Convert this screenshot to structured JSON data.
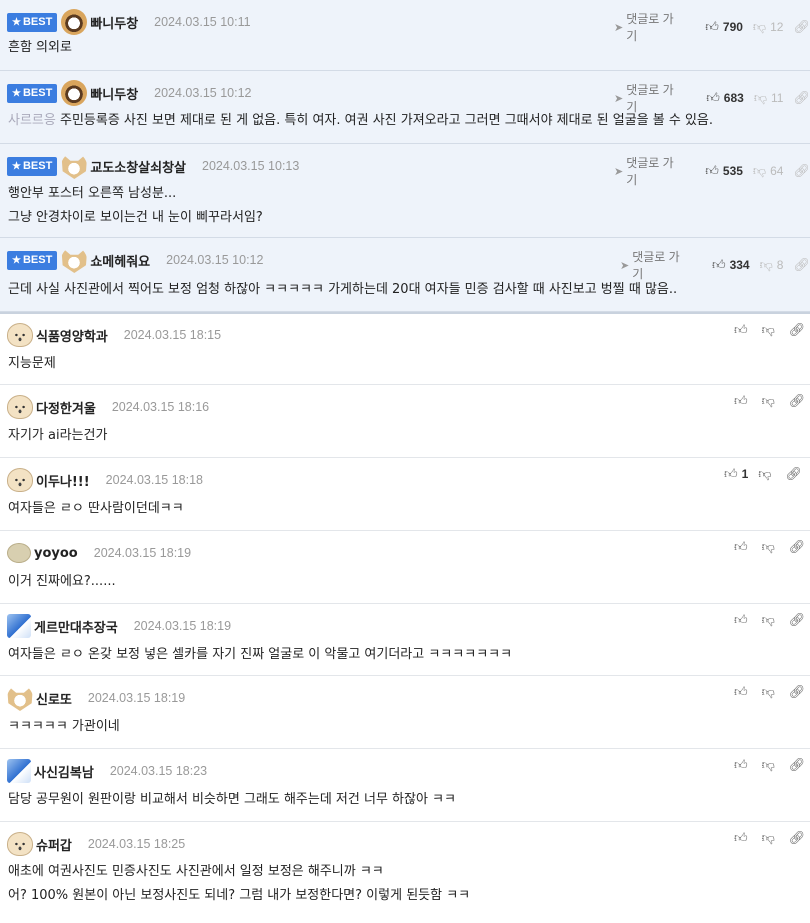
{
  "best_label": "BEST",
  "reply_label": "댓글로 가기",
  "best_comments": [
    {
      "nick": "빠니두창",
      "date": "2024.03.15 10:11",
      "up": "790",
      "down": "12",
      "lines": [
        "흔함 의외로"
      ]
    },
    {
      "nick": "빠니두창",
      "date": "2024.03.15 10:12",
      "up": "683",
      "down": "11",
      "reply_to": "사르르응",
      "lines": [
        "주민등록증 사진 보면 제대로 된 게 없음. 특히 여자. 여권 사진 가져오라고 그러면 그때서야 제대로 된 얼굴을 볼 수 있음."
      ]
    },
    {
      "nick": "교도소창살쇠창살",
      "date": "2024.03.15 10:13",
      "up": "535",
      "down": "64",
      "lines": [
        "행안부 포스터 오른쪽 남성분...",
        "그냥 안경차이로 보이는건 내 눈이 삐꾸라서임?"
      ]
    },
    {
      "nick": "쇼메헤줘요",
      "date": "2024.03.15 10:12",
      "up": "334",
      "down": "8",
      "lines": [
        "근데 사실 사진관에서 찍어도 보정 엄청 하잖아 ㅋㅋㅋㅋㅋ 가게하는데 20대 여자들 민증 검사할 때 사진보고 벙찔 때 많음.."
      ]
    }
  ],
  "comments": [
    {
      "nick": "식품영양학과",
      "date": "2024.03.15 18:15",
      "up": "",
      "lines": [
        "지능문제"
      ]
    },
    {
      "nick": "다정한겨울",
      "date": "2024.03.15 18:16",
      "up": "",
      "lines": [
        "자기가 ai라는건가"
      ]
    },
    {
      "nick": "이두나!!!",
      "date": "2024.03.15 18:18",
      "up": "1",
      "lines": [
        "여자들은 ㄹㅇ 딴사람이던데ㅋㅋ"
      ]
    },
    {
      "nick": "yoyoo",
      "date": "2024.03.15 18:19",
      "up": "",
      "lines": [
        "이거 진짜에요?......"
      ]
    },
    {
      "nick": "게르만대추장국",
      "date": "2024.03.15 18:19",
      "up": "",
      "lines": [
        "여자들은 ㄹㅇ 온갖 보정 넣은 셀카를 자기 진짜 얼굴로 이 악물고 여기더라고 ㅋㅋㅋㅋㅋㅋㅋ"
      ]
    },
    {
      "nick": "신로또",
      "date": "2024.03.15 18:19",
      "up": "",
      "lines": [
        "ㅋㅋㅋㅋㅋ 가관이네"
      ]
    },
    {
      "nick": "사신김복남",
      "date": "2024.03.15 18:23",
      "up": "",
      "lines": [
        "담당 공무원이 원판이랑 비교해서 비슷하면 그래도 해주는데 저건 너무 하잖아 ㅋㅋ"
      ]
    },
    {
      "nick": "슈퍼갑",
      "date": "2024.03.15 18:25",
      "up": "",
      "lines": [
        "애초에 여권사진도 민증사진도 사진관에서 일정 보정은 해주니까 ㅋㅋ",
        "어? 100% 원본이 아닌 보정사진도 되네? 그럼 내가 보정한다면? 이렇게 된듯함 ㅋㅋ"
      ]
    }
  ]
}
